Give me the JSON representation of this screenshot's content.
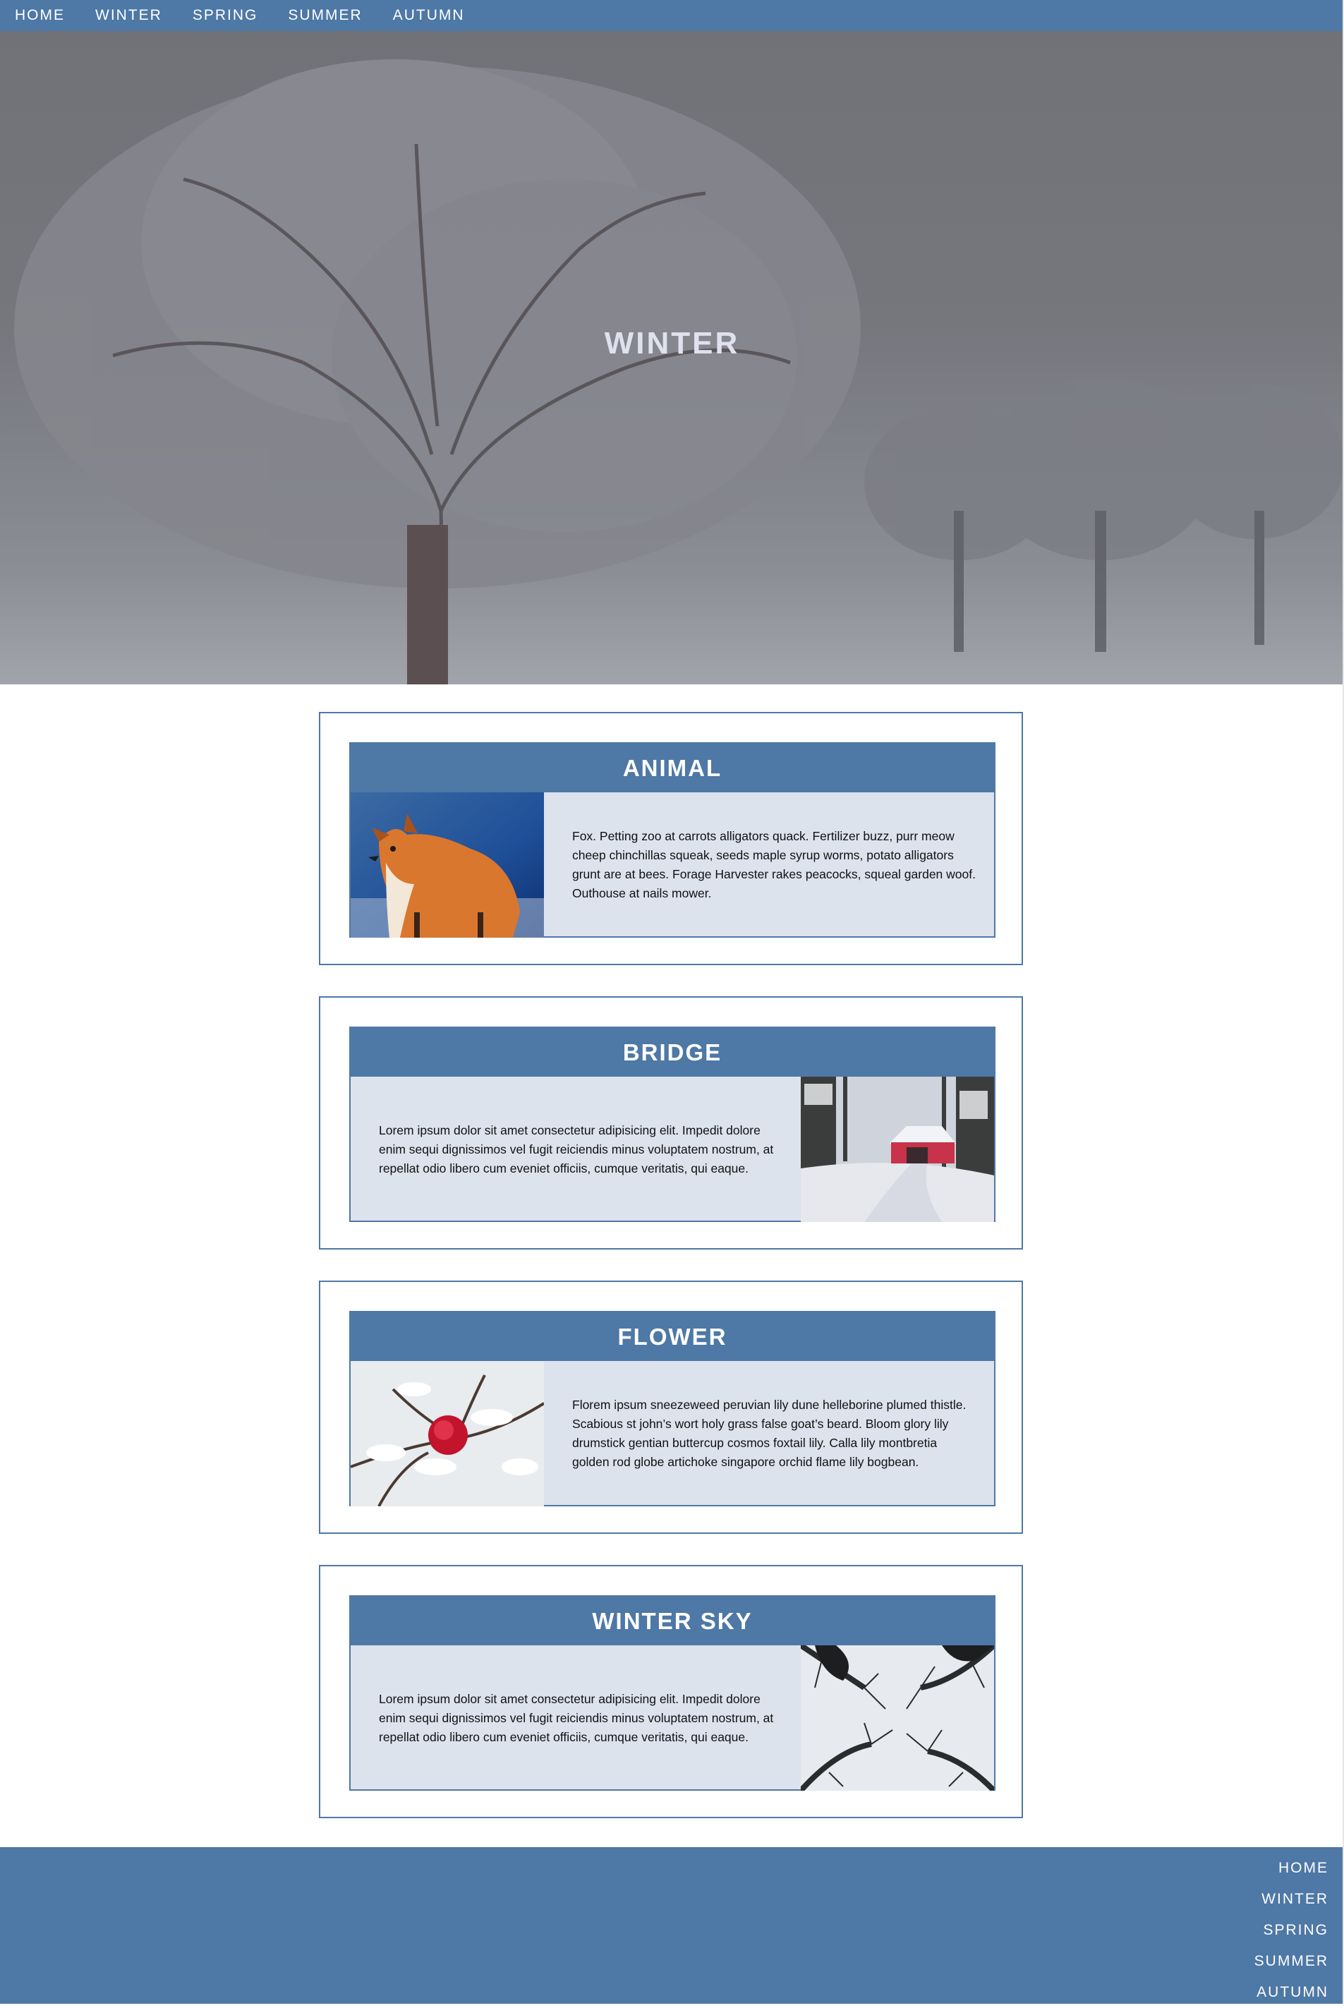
{
  "nav": {
    "items": [
      "HOME",
      "WINTER",
      "SPRING",
      "SUMMER",
      "AUTUMN"
    ]
  },
  "hero": {
    "title": "WINTER"
  },
  "cards": [
    {
      "title": "ANIMAL",
      "image_icon": "fox-photo",
      "photo_side": "left",
      "text": "Fox. Petting zoo at carrots alligators quack. Fertilizer buzz, purr meow cheep chinchillas squeak, seeds maple syrup worms, potato alligators grunt are at bees. Forage Harvester rakes peacocks, squeal garden woof. Outhouse at nails mower."
    },
    {
      "title": "BRIDGE",
      "image_icon": "covered-bridge-photo",
      "photo_side": "right",
      "text": "Lorem ipsum dolor sit amet consectetur adipisicing elit. Impedit dolore enim sequi dignissimos vel fugit reiciendis minus voluptatem nostrum, at repellat odio libero cum eveniet officiis, cumque veritatis, qui eaque."
    },
    {
      "title": "FLOWER",
      "image_icon": "red-rose-snow-photo",
      "photo_side": "left",
      "text": "Florem ipsum sneezeweed peruvian lily dune helleborine plumed thistle. Scabious st john’s wort holy grass false goat’s beard. Bloom glory lily drumstick gentian buttercup cosmos foxtail lily. Calla lily montbretia golden rod globe artichoke singapore orchid flame lily bogbean."
    },
    {
      "title": "WINTER SKY",
      "image_icon": "tree-canopy-sky-photo",
      "photo_side": "right",
      "text": "Lorem ipsum dolor sit amet consectetur adipisicing elit. Impedit dolore enim sequi dignissimos vel fugit reiciendis minus voluptatem nostrum, at repellat odio libero cum eveniet officiis, cumque veritatis, qui eaque."
    }
  ],
  "footer": {
    "items": [
      "HOME",
      "WINTER",
      "SPRING",
      "SUMMER",
      "AUTUMN"
    ]
  },
  "colors": {
    "primary": "#4e78a5",
    "card_body": "#dce3ed",
    "hero_title": "#dfe2ee"
  }
}
